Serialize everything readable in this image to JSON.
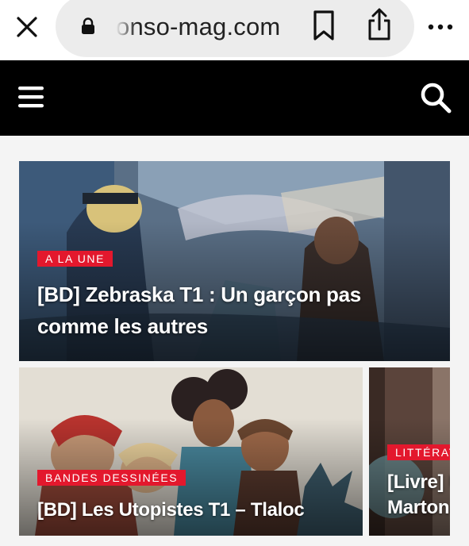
{
  "browser": {
    "url": "onso-mag.com",
    "close_icon": "close-icon",
    "lock_icon": "lock-icon",
    "bookmark_icon": "bookmark-icon",
    "share_icon": "share-icon",
    "more_icon": "more-horizontal-icon"
  },
  "site_header": {
    "menu_icon": "hamburger-menu-icon",
    "search_icon": "search-icon",
    "background": "#000000"
  },
  "articles": [
    {
      "category": "A LA UNE",
      "title": "[BD] Zebraska T1 : Un garçon pas comme les autres"
    },
    {
      "category": "BANDES DESSINÉES",
      "title": "[BD] Les Utopistes T1 – Tlaloc"
    },
    {
      "category": "LITTÉRAT",
      "title": "[Livre] U Marton"
    }
  ],
  "colors": {
    "badge": "#e3182d",
    "url_pill": "#ececec"
  }
}
